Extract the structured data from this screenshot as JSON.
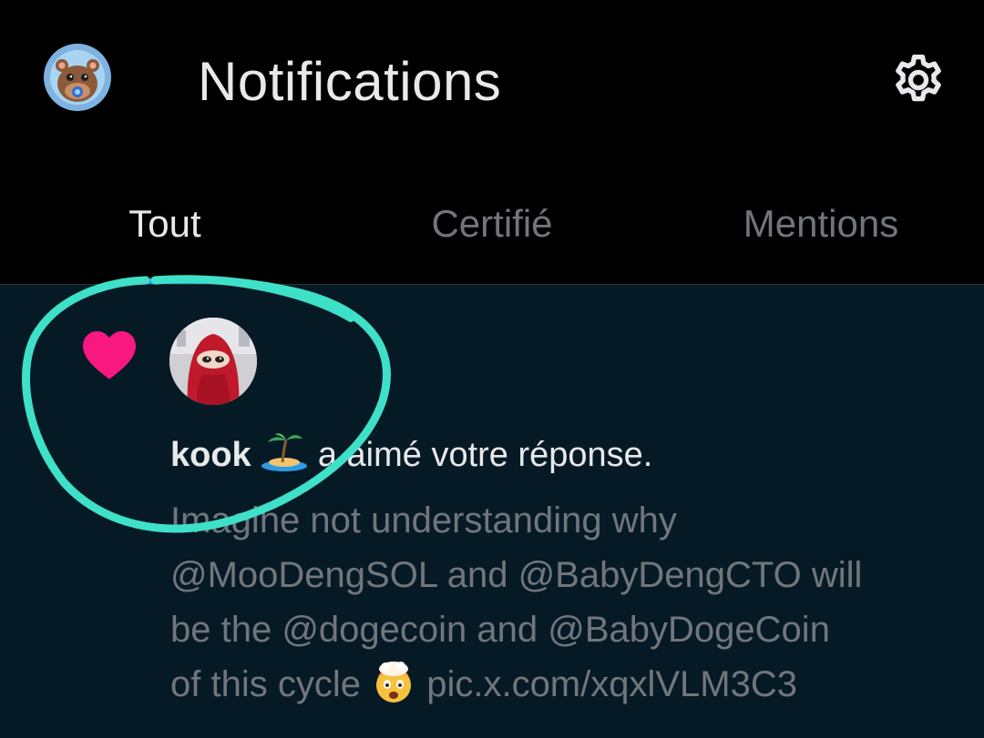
{
  "header": {
    "title": "Notifications",
    "avatar_icon": "hippo-avatar",
    "settings_icon": "gear-icon"
  },
  "tabs": [
    {
      "label": "Tout",
      "active": true
    },
    {
      "label": "Certifié",
      "active": false
    },
    {
      "label": "Mentions",
      "active": false
    }
  ],
  "notification": {
    "type_icon": "heart-icon",
    "user_name": "kook",
    "user_emoji": "desert-island-emoji",
    "action_text": "a aimé votre réponse.",
    "tweet": {
      "line1": "Imagine not understanding why",
      "mention1": "@MooDengSOL",
      "and1": " and ",
      "mention2": "@BabyDengCTO",
      "will": " will",
      "be_the": "be the ",
      "mention3": "@dogecoin",
      "and2": " and ",
      "mention4": "@BabyDogeCoin",
      "of_this": "of this cycle ",
      "emoji": "exploding-head-emoji",
      "link": "pic.x.com/xqxlVLM3C3"
    }
  },
  "colors": {
    "background": "#000000",
    "notification_bg": "#061a26",
    "heart": "#f91880",
    "accent": "#1d9bf0",
    "annotation": "#3ee0c8",
    "muted_text": "#71767b",
    "primary_text": "#e7e9ea"
  }
}
